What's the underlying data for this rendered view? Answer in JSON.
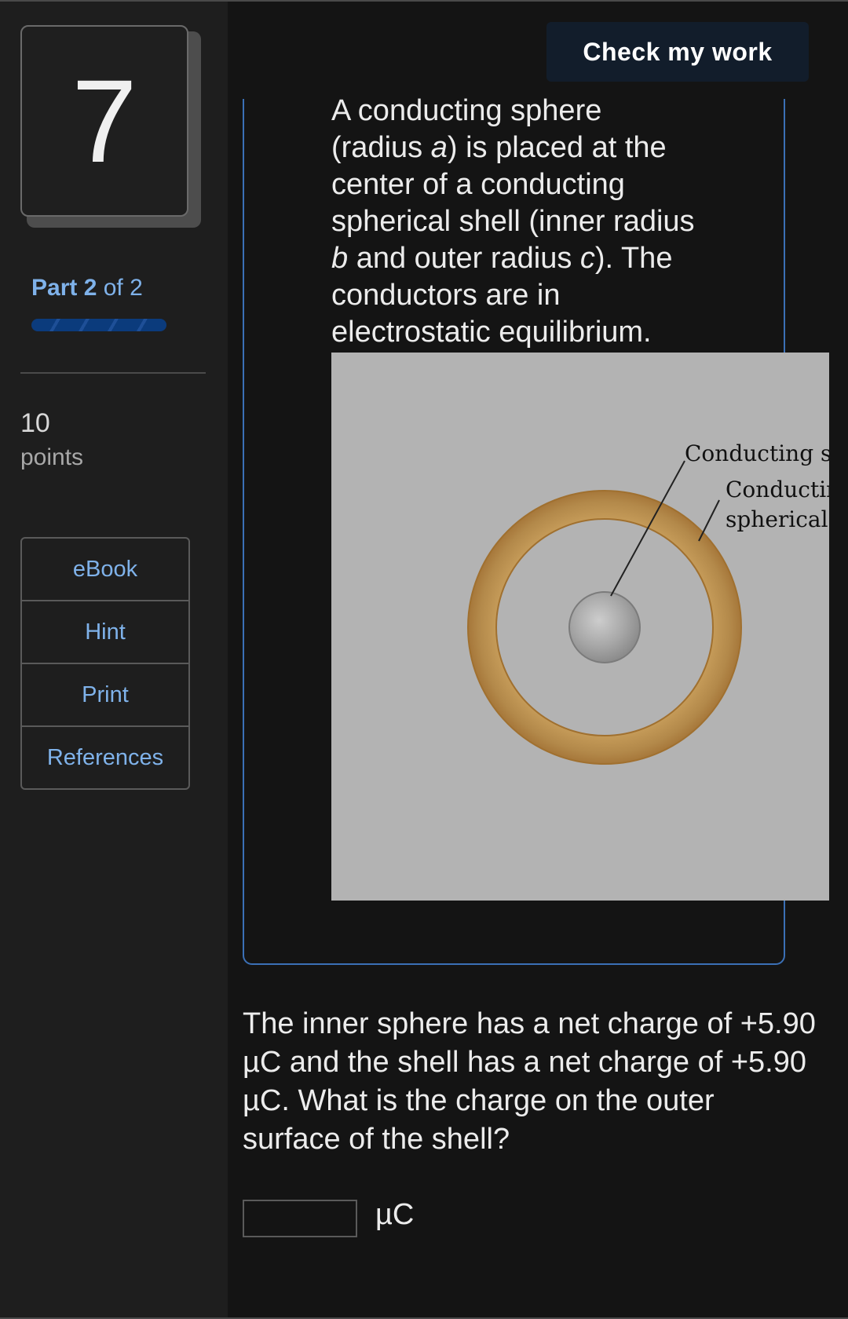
{
  "sidebar": {
    "question_number": "7",
    "part": {
      "word": "Part",
      "current": "2",
      "of_total": "of 2"
    },
    "points": {
      "value": "10",
      "label": "points"
    },
    "tools": [
      {
        "label": "eBook"
      },
      {
        "label": "Hint"
      },
      {
        "label": "Print"
      },
      {
        "label": "References"
      }
    ]
  },
  "header": {
    "check_button": "Check my work"
  },
  "intro": {
    "t1": "A conducting sphere (radius ",
    "a": "a",
    "t2": ") is placed at the center of a conducting spherical shell (inner radius ",
    "b": "b",
    "t3": " and outer radius ",
    "c": "c",
    "t4": "). The conductors are in electrostatic equilibrium."
  },
  "figure": {
    "label_sphere": "Conducting sphere",
    "label_shell_line1": "Conducting",
    "label_shell_line2": "spherical shell"
  },
  "question": {
    "text": "The inner sphere has a net charge of +5.90 µC and the shell has a net charge of +5.90 µC. What is the charge on the outer surface of the shell?"
  },
  "answer": {
    "value": "",
    "unit": "µC"
  },
  "colors": {
    "accent": "#7fb2ea",
    "border_blue": "#3b70b6",
    "shell": "#b78a45",
    "figure_bg": "#b3b3b3"
  }
}
